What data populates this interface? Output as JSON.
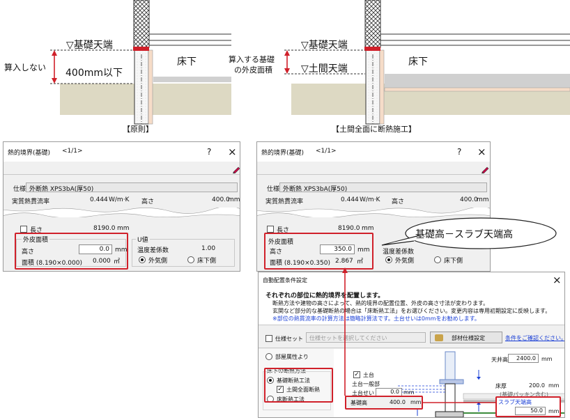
{
  "diagram_left": {
    "top_label": "▽基礎天端",
    "side_label": "算入しない",
    "height_label": "400mm以下",
    "under_label": "床下",
    "caption": "【原則】"
  },
  "diagram_right": {
    "top_label": "▽基礎天端",
    "side_label_1": "算入する基礎",
    "side_label_2": "の外皮面積",
    "slab_label": "▽土間天端",
    "under_label": "床下",
    "caption": "【土間全面に断熱施工】"
  },
  "dialog_left": {
    "title": "熱的境界(基礎)",
    "page": "<1/1>",
    "help": "?",
    "close": "×",
    "spec_label": "仕様",
    "spec_value": "外断熱 XPS3bA(厚50)",
    "flow_label": "実質熱貫流率",
    "flow_value": "0.444",
    "flow_unit": "W/m·K",
    "height_label": "高さ",
    "height_value": "400.0",
    "height_unit": "mm",
    "length_label": "長さ",
    "length_value": "8190.0",
    "length_unit": "mm",
    "skin_group": "外皮面積",
    "skin_height_label": "高さ",
    "skin_height_value": "0.0",
    "skin_height_unit": "mm",
    "area_label": "面積 (8.190×0.000)",
    "area_value": "0.000",
    "area_unit": "㎡",
    "u_group": "U値",
    "temp_label": "温度差係数",
    "temp_value": "1.00",
    "radio_outside": "外気側",
    "radio_underfloor": "床下側"
  },
  "dialog_right": {
    "title": "熱的境界(基礎)",
    "page": "<1/1>",
    "help": "?",
    "close": "×",
    "spec_label": "仕様",
    "spec_value": "外断熱 XPS3bA(厚50)",
    "flow_label": "実質熱貫流率",
    "flow_value": "0.444",
    "flow_unit": "W/m·K",
    "height_label": "高さ",
    "height_value": "400.0",
    "height_unit": "mm",
    "length_label": "長さ",
    "length_value": "8190.0",
    "length_unit": "mm",
    "skin_group": "外皮面積",
    "skin_height_label": "高さ",
    "skin_height_value": "350.0",
    "skin_height_unit": "mm",
    "area_label": "面積 (8.190×0.350)",
    "area_value": "2.867",
    "area_unit": "㎡",
    "temp_label": "温度差係数",
    "radio_outside": "外気側",
    "radio_underfloor": "床下側"
  },
  "callout": "基礎高－スラブ天端高",
  "auto_dialog": {
    "title": "自動配置条件設定",
    "close": "×",
    "heading": "それぞれの部位に熱的境界を配置します。",
    "desc1": "断熱方法や建物の高さによって、熱的境界の配置位置、外皮の高さ寸法が変わります。",
    "desc2": "玄関など部分的な基礎断熱の場合は「床断熱工法」をお選びください。変更内容は専用初期設定に反映します。",
    "desc3": "※部位の熱貫流率の計算方法は簡略計算法です。土台せいは0mmをお勧めします。",
    "spec_set_label": "仕様セット",
    "spec_set_placeholder": "仕様セットを選択してください",
    "parts_button": "部材仕様設定",
    "confirm_link": "条件をご確認ください。",
    "room_attr": "部屋属性より",
    "method_group": "床下の断熱方法",
    "method_foundation": "基礎断熱工法",
    "method_full_slab": "土間全面断熱",
    "method_floor": "床断熱工法",
    "ceiling_label": "天井高",
    "ceiling_value": "2400.0",
    "ceiling_unit": "mm",
    "sill_label": "土台",
    "sill_general": "土台一般部",
    "sill_height_label": "土台せい",
    "sill_height_value": "0.0",
    "sill_height_unit": "mm",
    "floor_thick_label": "床厚",
    "floor_thick_value": "200.0",
    "floor_thick_unit": "mm",
    "floor_note": "(基礎パッキン含む)",
    "found_height_label": "基礎高",
    "found_height_value": "400.0",
    "found_height_unit": "mm",
    "slab_label": "スラブ天端高",
    "slab_value": "50.0",
    "slab_unit": "mm"
  },
  "colors": {
    "red": "#d0202a",
    "ground": "#ddd9c3",
    "blue_text": "#1a3fd6",
    "slab": "#d0d0d0"
  }
}
